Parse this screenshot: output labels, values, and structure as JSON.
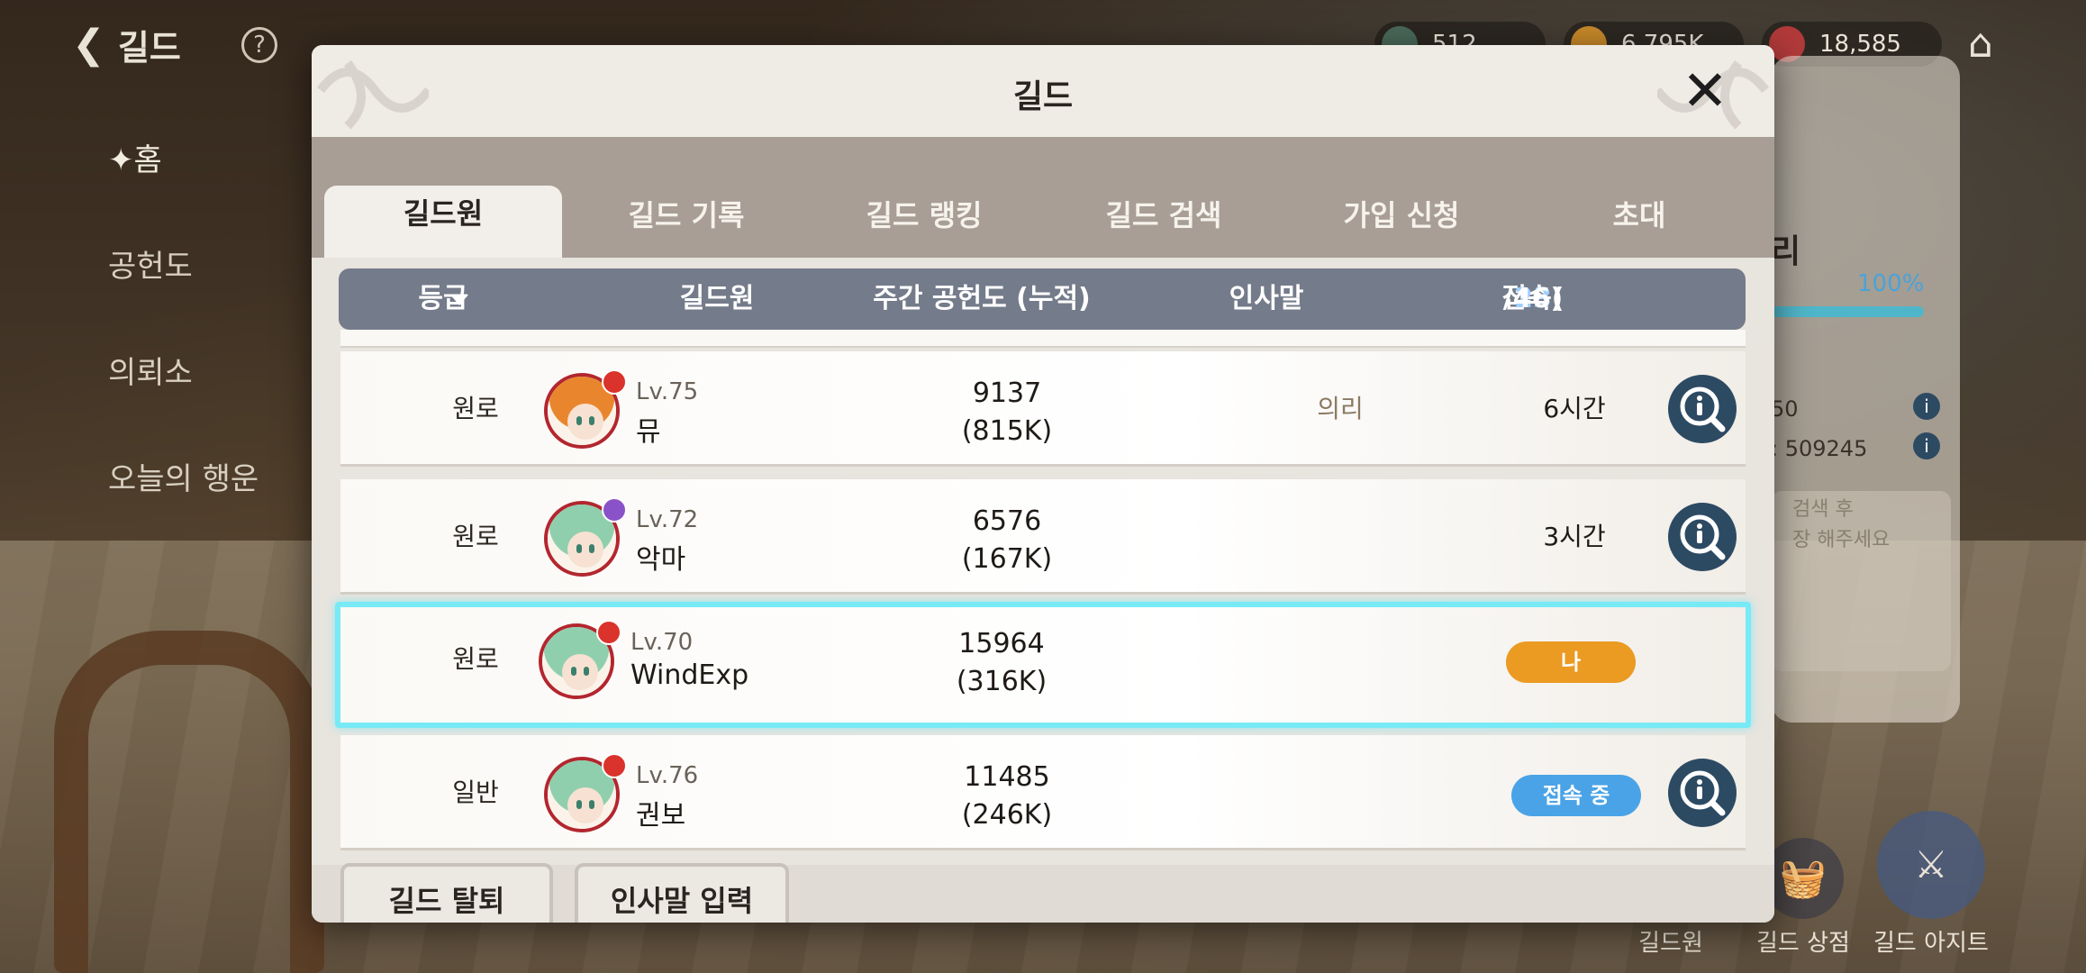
{
  "hud": {
    "back_label": "길드",
    "help_glyph": "?",
    "side_menu": [
      {
        "label": "홈",
        "active": true
      },
      {
        "label": "공헌도",
        "active": false
      },
      {
        "label": "의뢰소",
        "active": false
      },
      {
        "label": "오늘의 행운",
        "active": false
      }
    ],
    "currencies": [
      {
        "value": "512",
        "color": "#4a6a5a"
      },
      {
        "value": "6,795K",
        "color": "#c98a2a"
      },
      {
        "value": "18,585",
        "color": "#b23a3a"
      }
    ],
    "right_panel": {
      "title": "리",
      "percent": "100%",
      "line1": "50",
      "line2": ": 509245",
      "note": "검색 후\n장 해주세요"
    },
    "bottom_nav": [
      {
        "label": "길드원",
        "icon": "members-icon"
      },
      {
        "label": "길드 상점",
        "icon": "basket-icon"
      },
      {
        "label": "길드 아지트",
        "icon": "swords-icon"
      }
    ]
  },
  "dialog": {
    "title": "길드",
    "tabs": [
      {
        "label": "길드원",
        "active": true
      },
      {
        "label": "길드 기록",
        "active": false
      },
      {
        "label": "길드 랭킹",
        "active": false
      },
      {
        "label": "길드 검색",
        "active": false
      },
      {
        "label": "가입 신청",
        "active": false
      },
      {
        "label": "초대",
        "active": false
      }
    ],
    "columns": {
      "grade": "등급",
      "member": "길드원",
      "weekly": "주간 공헌도 (누적)",
      "greeting": "인사말",
      "online_prefix": "접속(",
      "online_count": "23",
      "online_suffix": "/46)"
    },
    "members": [
      {
        "grade": "원로",
        "level": "Lv.75",
        "name": "뮤",
        "weekly": "9137",
        "total": "(815K)",
        "greeting": "의리",
        "last_login": "6시간",
        "status": "",
        "is_me": false,
        "hair": "#e9862d",
        "flower": "#d9332b"
      },
      {
        "grade": "원로",
        "level": "Lv.72",
        "name": "악마",
        "weekly": "6576",
        "total": "(167K)",
        "greeting": "",
        "last_login": "3시간",
        "status": "",
        "is_me": false,
        "hair": "#8fcfae",
        "flower": "#8a52c8"
      },
      {
        "grade": "원로",
        "level": "Lv.70",
        "name": "WindExp",
        "weekly": "15964",
        "total": "(316K)",
        "greeting": "",
        "last_login": "",
        "status": "나",
        "is_me": true,
        "hair": "#8fcfae",
        "flower": "#d9332b"
      },
      {
        "grade": "일반",
        "level": "Lv.76",
        "name": "권보",
        "weekly": "11485",
        "total": "(246K)",
        "greeting": "",
        "last_login": "",
        "status": "접속 중",
        "is_me": false,
        "hair": "#8fcfae",
        "flower": "#d9332b"
      }
    ],
    "footer": {
      "leave_label": "길드 탈퇴",
      "greeting_label": "인사말 입력"
    }
  }
}
